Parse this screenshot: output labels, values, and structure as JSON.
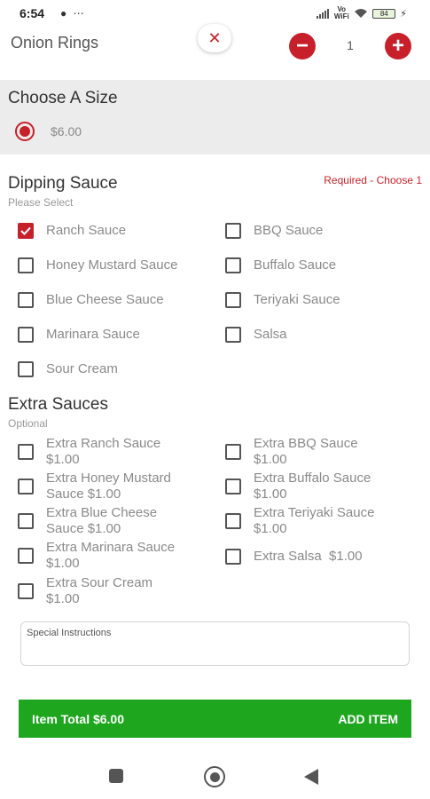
{
  "status_bar": {
    "time": "6:54",
    "left_icons": "● ⋯",
    "network": "Vo WiFi",
    "battery": "84"
  },
  "header": {
    "title": "Onion Rings",
    "close_symbol": "✕",
    "quantity": "1",
    "minus_symbol": "−",
    "plus_symbol": "+"
  },
  "size_section": {
    "heading": "Choose A Size",
    "options": [
      {
        "label": "$6.00",
        "selected": true
      }
    ]
  },
  "dipping_sauce": {
    "heading": "Dipping Sauce",
    "subtitle": "Please Select",
    "requirement": "Required - Choose 1",
    "options": [
      {
        "label": "Ranch Sauce",
        "checked": true
      },
      {
        "label": "BBQ Sauce",
        "checked": false
      },
      {
        "label": "Honey Mustard Sauce",
        "checked": false
      },
      {
        "label": "Buffalo Sauce",
        "checked": false
      },
      {
        "label": "Blue Cheese Sauce",
        "checked": false
      },
      {
        "label": "Teriyaki Sauce",
        "checked": false
      },
      {
        "label": "Marinara Sauce",
        "checked": false
      },
      {
        "label": "Salsa",
        "checked": false
      },
      {
        "label": "Sour Cream",
        "checked": false
      }
    ]
  },
  "extra_sauces": {
    "heading": "Extra Sauces",
    "subtitle": "Optional",
    "options": [
      {
        "line1": "Extra Ranch Sauce",
        "line2": "$1.00"
      },
      {
        "line1": "Extra BBQ Sauce",
        "line2": "$1.00"
      },
      {
        "line1": "Extra Honey Mustard",
        "line2": "Sauce $1.00"
      },
      {
        "line1": "Extra Buffalo Sauce",
        "line2": "$1.00"
      },
      {
        "line1": "Extra Blue Cheese",
        "line2": "Sauce $1.00"
      },
      {
        "line1": "Extra Teriyaki Sauce",
        "line2": "$1.00"
      },
      {
        "line1": "Extra Marinara Sauce",
        "line2": "$1.00"
      },
      {
        "line1": "Extra Salsa  $1.00",
        "line2": ""
      },
      {
        "line1": "Extra Sour Cream",
        "line2": "$1.00"
      }
    ]
  },
  "special_instructions": {
    "label": "Special Instructions"
  },
  "footer": {
    "total": "Item Total $6.00",
    "add_label": "ADD ITEM"
  },
  "colors": {
    "accent": "#c8202a",
    "add_bar": "#1fa61f",
    "size_bg": "#ececec"
  }
}
